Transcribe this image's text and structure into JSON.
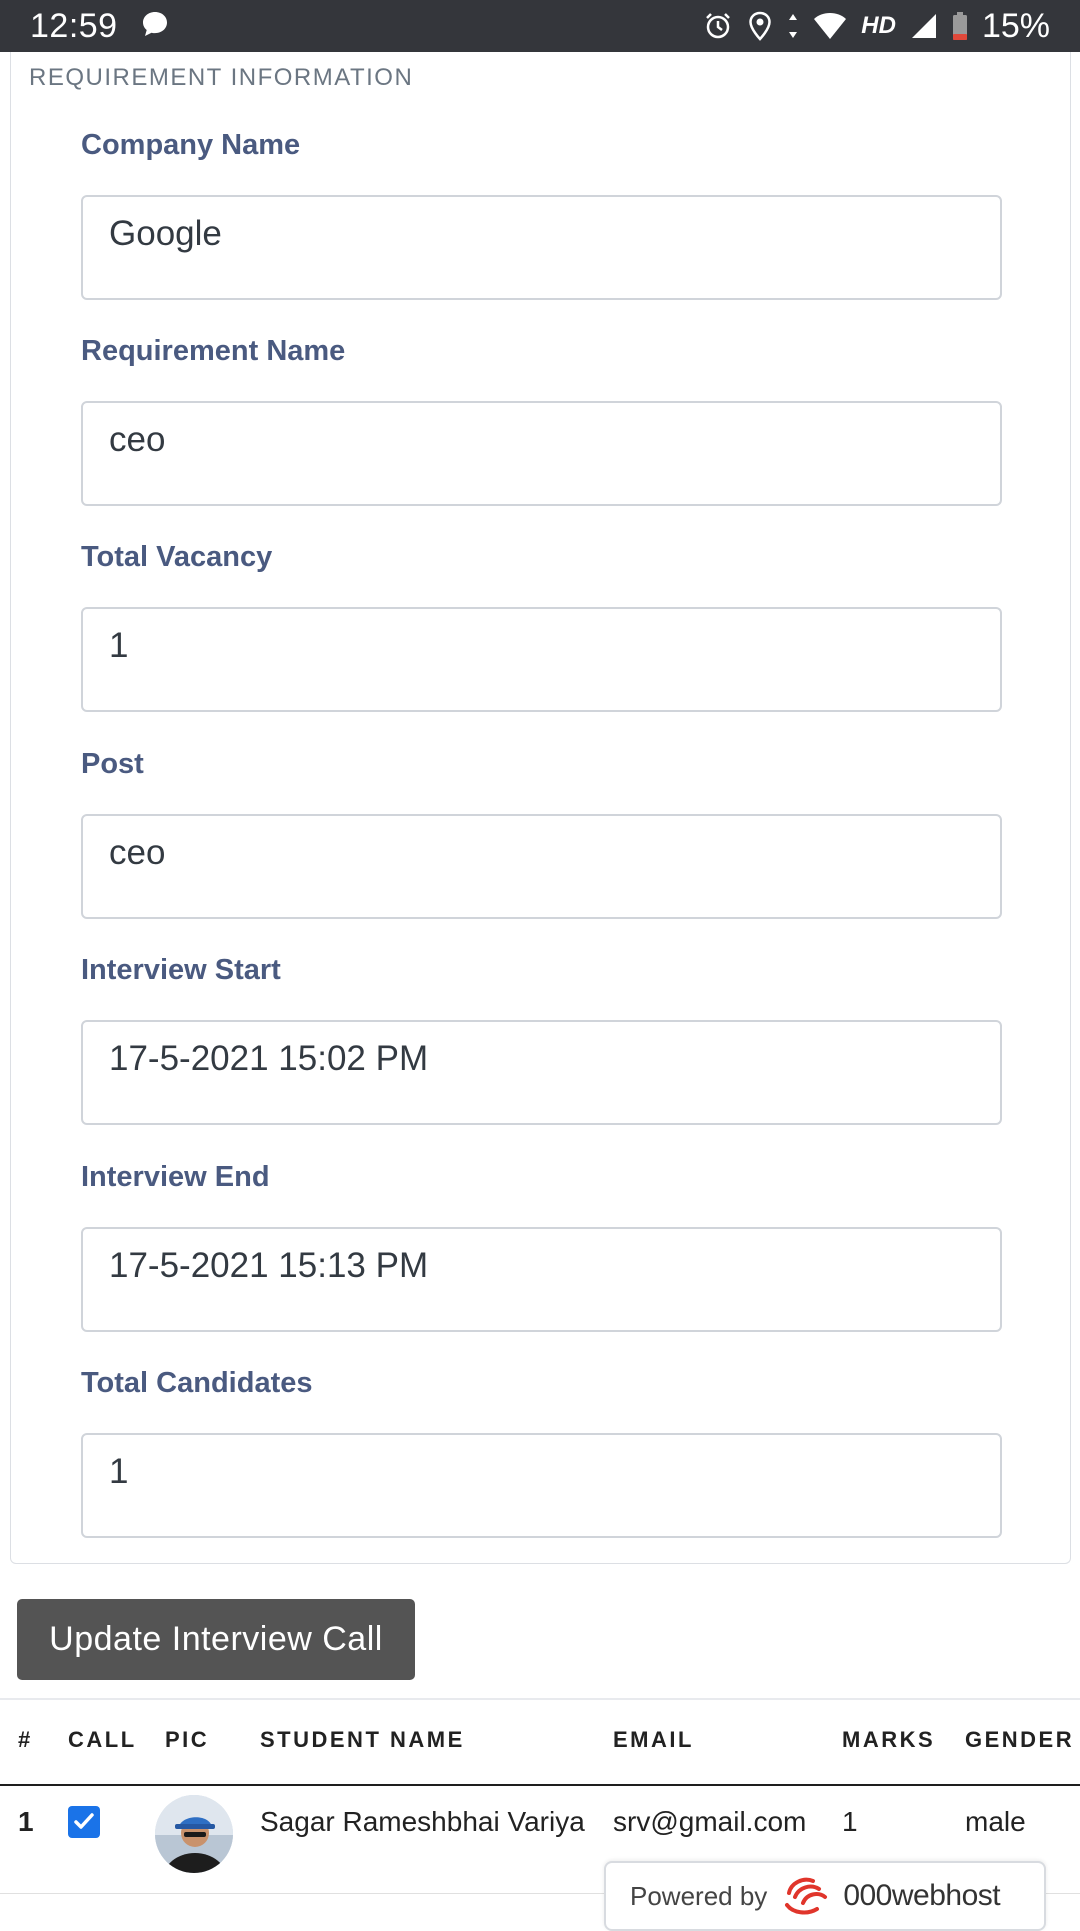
{
  "status_bar": {
    "time": "12:59",
    "battery_percent": "15%",
    "network_label": "HD"
  },
  "card": {
    "header": "REQUIREMENT INFORMATION",
    "fields": [
      {
        "label": "Company Name",
        "value": "Google"
      },
      {
        "label": "Requirement Name",
        "value": "ceo"
      },
      {
        "label": "Total Vacancy",
        "value": "1"
      },
      {
        "label": "Post",
        "value": "ceo"
      },
      {
        "label": "Interview Start",
        "value": "17-5-2021 15:02 PM"
      },
      {
        "label": "Interview End",
        "value": "17-5-2021 15:13 PM"
      },
      {
        "label": "Total Candidates",
        "value": "1"
      }
    ]
  },
  "actions": {
    "update_label": "Update Interview Call"
  },
  "table": {
    "columns": [
      "#",
      "CALL",
      "PIC",
      "STUDENT NAME",
      "EMAIL",
      "MARKS",
      "GENDER"
    ],
    "rows": [
      {
        "num": "1",
        "call_checked": true,
        "name": "Sagar Rameshbhai Variya",
        "email": "srv@gmail.com",
        "marks": "1",
        "gender": "male"
      }
    ]
  },
  "badge": {
    "powered_text": "Powered by",
    "brand": "000webhost"
  },
  "colors": {
    "status_bar": "#34363b",
    "label": "#4a5a80",
    "button": "#545454",
    "checkbox": "#1a73e8"
  }
}
